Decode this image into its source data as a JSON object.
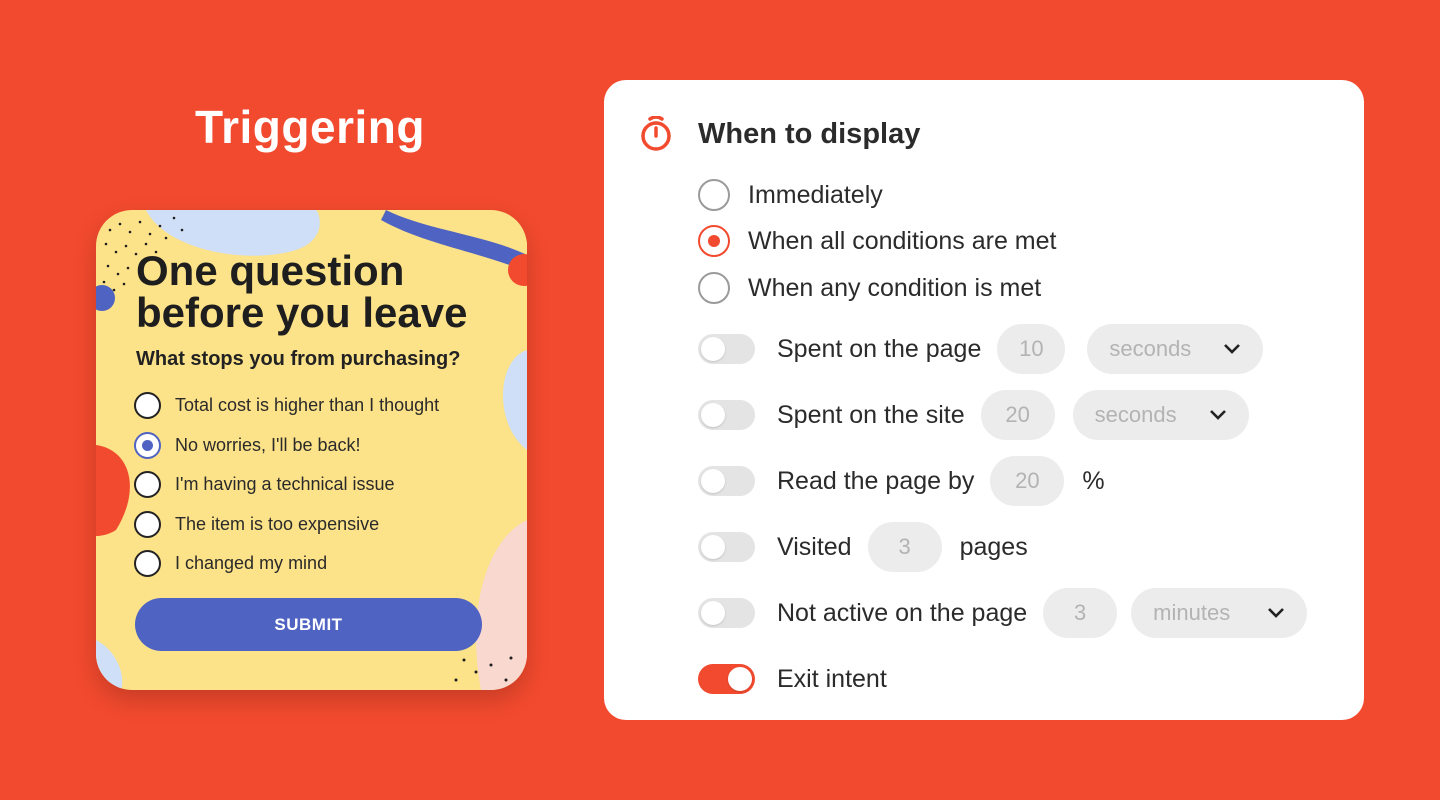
{
  "heading": "Triggering",
  "survey": {
    "title": "One question before you leave",
    "subtitle": "What stops you from purchasing?",
    "options": [
      {
        "label": "Total cost is higher than I thought",
        "selected": false
      },
      {
        "label": "No worries, I'll be back!",
        "selected": true
      },
      {
        "label": "I'm having a technical issue",
        "selected": false
      },
      {
        "label": "The item is too expensive",
        "selected": false
      },
      {
        "label": "I changed my mind",
        "selected": false
      }
    ],
    "submit_label": "SUBMIT",
    "colors": {
      "background": "#fce288",
      "accent": "#4f63c2"
    }
  },
  "panel": {
    "title": "When to display",
    "icon": "timer-icon",
    "display_modes": [
      {
        "label": "Immediately",
        "selected": false
      },
      {
        "label": "When all conditions are met",
        "selected": true
      },
      {
        "label": "When any condition is met",
        "selected": false
      }
    ],
    "conditions": [
      {
        "label": "Spent on the page",
        "enabled": false,
        "value": "10",
        "unit": "seconds"
      },
      {
        "label": "Spent on the site",
        "enabled": false,
        "value": "20",
        "unit": "seconds"
      },
      {
        "label": "Read the page by",
        "enabled": false,
        "value": "20",
        "suffix": "%"
      },
      {
        "label": "Visited",
        "enabled": false,
        "value": "3",
        "suffix": "pages"
      },
      {
        "label": "Not active on the page",
        "enabled": false,
        "value": "3",
        "unit": "minutes"
      },
      {
        "label": "Exit intent",
        "enabled": true
      }
    ]
  },
  "colors": {
    "page_background": "#f24a2e",
    "accent": "#f24a2e"
  }
}
